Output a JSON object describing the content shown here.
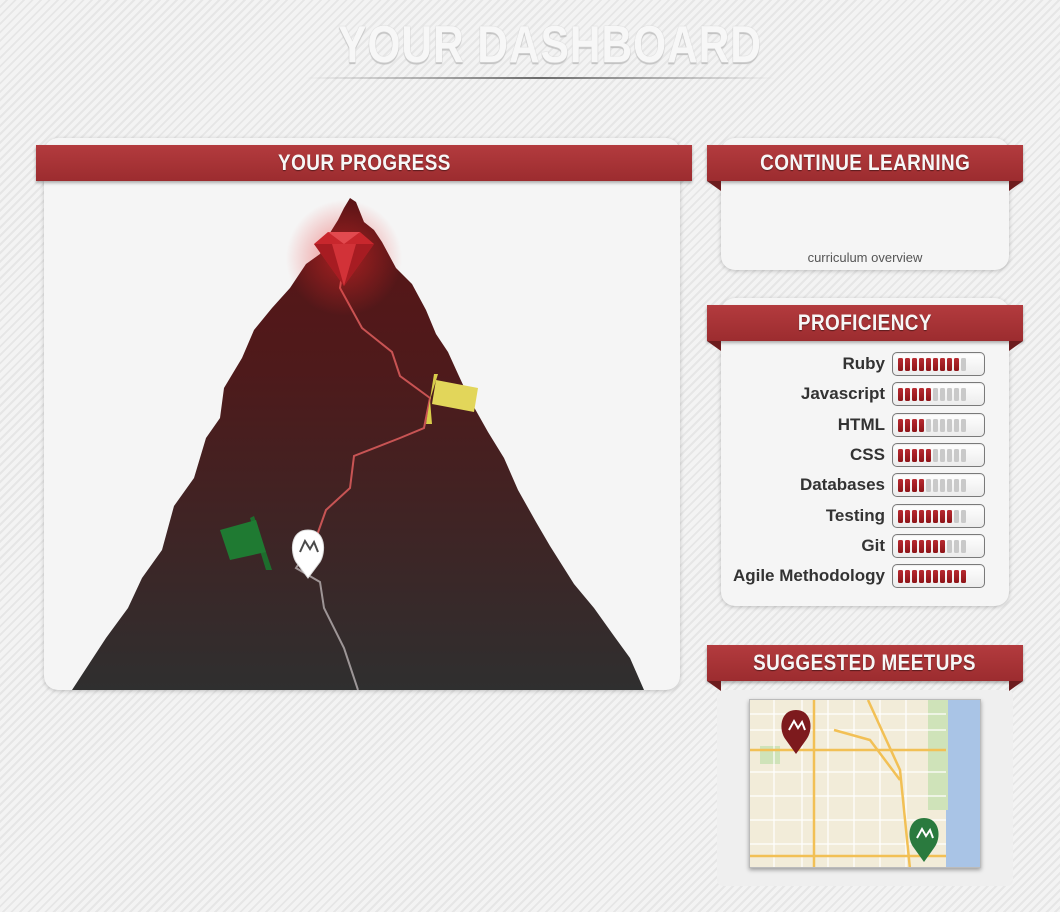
{
  "page": {
    "title": "YOUR DASHBOARD"
  },
  "progress": {
    "heading": "YOUR PROGRESS"
  },
  "continue_learning": {
    "heading": "CONTINUE LEARNING",
    "link_label": "curriculum overview"
  },
  "proficiency": {
    "heading": "PROFICIENCY",
    "max_level": 10,
    "skills": [
      {
        "name": "Ruby",
        "level": 9
      },
      {
        "name": "Javascript",
        "level": 5
      },
      {
        "name": "HTML",
        "level": 4
      },
      {
        "name": "CSS",
        "level": 5
      },
      {
        "name": "Databases",
        "level": 4
      },
      {
        "name": "Testing",
        "level": 8
      },
      {
        "name": "Git",
        "level": 7
      },
      {
        "name": "Agile Methodology",
        "level": 10
      }
    ]
  },
  "meetups": {
    "heading": "SUGGESTED MEETUPS"
  },
  "colors": {
    "ribbon_red": "#a63336",
    "meter_fill": "#a01c22",
    "flag_green": "#1f7a32",
    "flag_yellow": "#e2d65a",
    "ruby": "#c8272d"
  }
}
